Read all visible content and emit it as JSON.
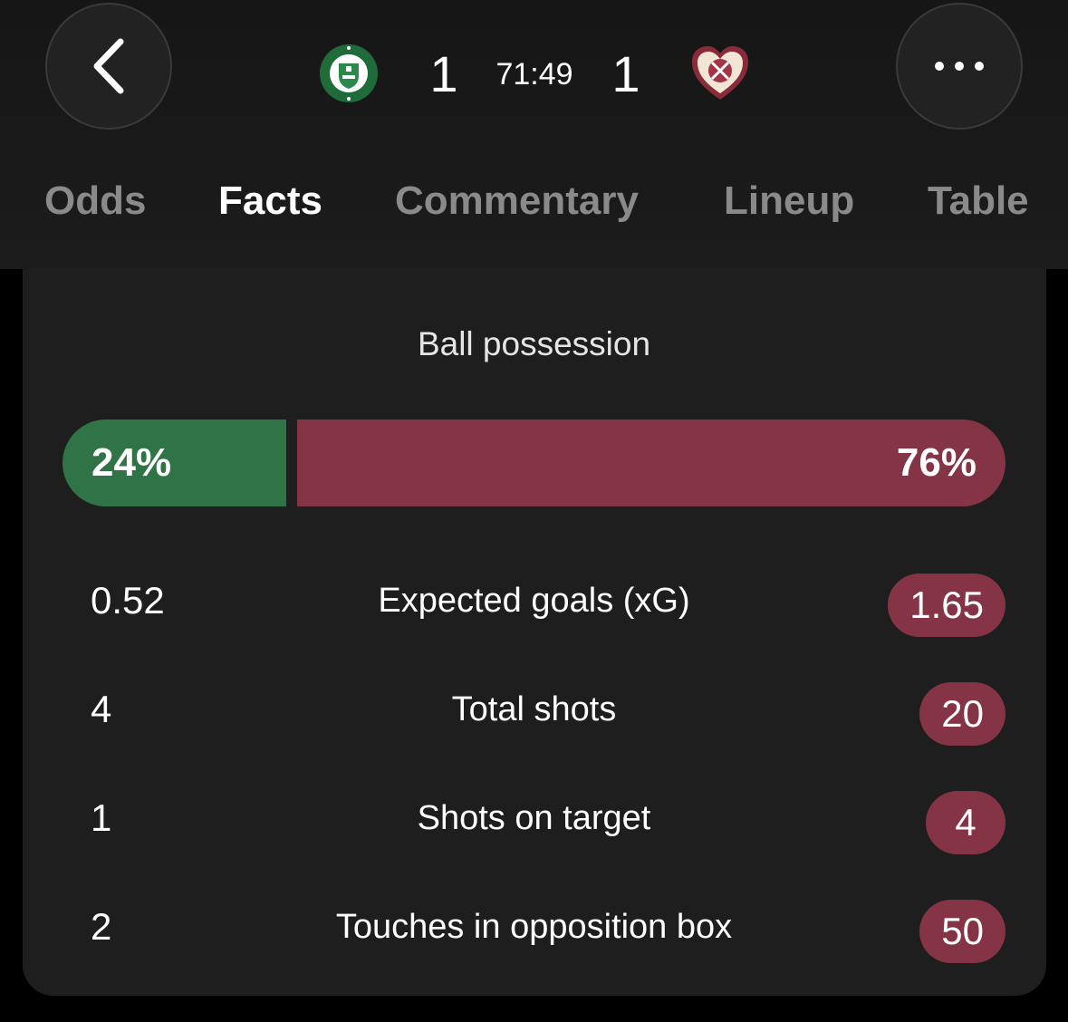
{
  "match": {
    "home_score": "1",
    "away_score": "1",
    "clock": "71:49"
  },
  "icons": {
    "back": "chevron-left-icon",
    "more": "ellipsis-icon",
    "home_crest": "hibernian-crest-icon",
    "away_crest": "hearts-crest-icon"
  },
  "tabs": [
    {
      "label": "Odds",
      "active": false
    },
    {
      "label": "Facts",
      "active": true
    },
    {
      "label": "Commentary",
      "active": false
    },
    {
      "label": "Lineup",
      "active": false
    },
    {
      "label": "Table",
      "active": false
    }
  ],
  "colors": {
    "home": "#2f7347",
    "away": "#853446"
  },
  "possession": {
    "title": "Ball possession",
    "home_value": 24,
    "away_value": 76,
    "home_label": "24%",
    "away_label": "76%"
  },
  "stats": [
    {
      "label": "Expected goals (xG)",
      "home": "0.52",
      "away": "1.65"
    },
    {
      "label": "Total shots",
      "home": "4",
      "away": "20"
    },
    {
      "label": "Shots on target",
      "home": "1",
      "away": "4"
    },
    {
      "label": "Touches in opposition box",
      "home": "2",
      "away": "50"
    }
  ]
}
